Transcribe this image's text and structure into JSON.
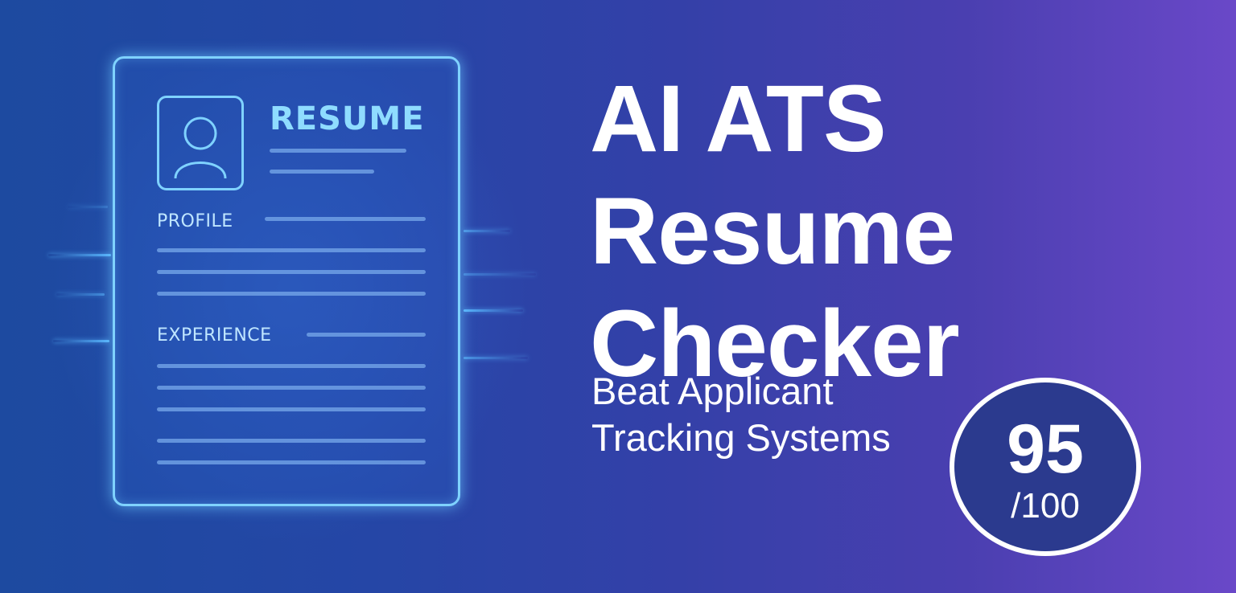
{
  "resume_card": {
    "title": "RESUME",
    "profile_label": "PROFILE",
    "experience_label": "EXPERIENCE",
    "avatar_icon": "user-icon"
  },
  "headline": {
    "line1": "AI ATS",
    "line2": "Resume",
    "line3": "Checker"
  },
  "subheadline": {
    "line1": "Beat Applicant",
    "line2": "Tracking Systems"
  },
  "score": {
    "value": "95",
    "total": "/100"
  },
  "colors": {
    "gradient_left": "#1d4aa0",
    "gradient_right": "#6a48c8",
    "glow": "#7fd2ff",
    "badge_fill": "#2b3a8e",
    "text": "#ffffff"
  }
}
